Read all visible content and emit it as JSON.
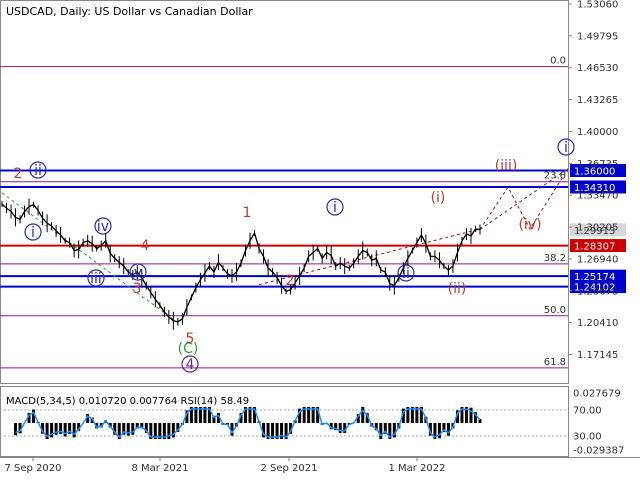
{
  "chart_data": {
    "type": "line",
    "title": "USDCAD, Daily:  US Dollar vs Canadian Dollar",
    "x_ticks": [
      "7 Sep 2020",
      "8 Mar 2021",
      "2 Sep 2021",
      "1 Mar 2022"
    ],
    "ylim": [
      1.154,
      1.532
    ],
    "y_ticks": [
      "1.53060",
      "1.49795",
      "1.46530",
      "1.43265",
      "1.40000",
      "1.36735",
      "1.33470",
      "1.30205",
      "1.26940",
      "1.23675",
      "1.20410",
      "1.17145"
    ],
    "price_label": "1.29913",
    "price_value": 1.29913,
    "key_levels": [
      {
        "label": "1.36000",
        "value": 1.36,
        "color": "#0000cc"
      },
      {
        "label": "1.34310",
        "value": 1.3431,
        "color": "#0000cc"
      },
      {
        "label": "1.28307",
        "value": 1.28307,
        "color": "#cc0000"
      },
      {
        "label": "1.25174",
        "value": 1.25174,
        "color": "#0000cc"
      },
      {
        "label": "1.24102",
        "value": 1.24102,
        "color": "#0000cc"
      }
    ],
    "fib_levels": [
      {
        "label": "0.0",
        "value": 1.4664
      },
      {
        "label": "23.6",
        "value": 1.3485
      },
      {
        "label": "38.2",
        "value": 1.2643
      },
      {
        "label": "50.0",
        "value": 1.2111
      },
      {
        "label": "61.8",
        "value": 1.1578
      }
    ],
    "price_series": [
      1.3256,
      1.3215,
      1.318,
      1.312,
      1.31,
      1.318,
      1.323,
      1.325,
      1.319,
      1.311,
      1.306,
      1.303,
      1.298,
      1.294,
      1.288,
      1.286,
      1.278,
      1.279,
      1.286,
      1.288,
      1.285,
      1.28,
      1.283,
      1.288,
      1.275,
      1.27,
      1.266,
      1.262,
      1.256,
      1.253,
      1.256,
      1.25,
      1.242,
      1.235,
      1.228,
      1.222,
      1.215,
      1.21,
      1.206,
      1.205,
      1.208,
      1.22,
      1.23,
      1.24,
      1.248,
      1.255,
      1.262,
      1.256,
      1.266,
      1.26,
      1.254,
      1.252,
      1.256,
      1.265,
      1.278,
      1.288,
      1.296,
      1.28,
      1.272,
      1.26,
      1.256,
      1.25,
      1.242,
      1.236,
      1.238,
      1.245,
      1.252,
      1.26,
      1.272,
      1.276,
      1.28,
      1.27,
      1.276,
      1.273,
      1.262,
      1.265,
      1.262,
      1.26,
      1.265,
      1.272,
      1.278,
      1.276,
      1.268,
      1.27,
      1.258,
      1.256,
      1.244,
      1.242,
      1.25,
      1.26,
      1.27,
      1.278,
      1.286,
      1.294,
      1.285,
      1.272,
      1.272,
      1.268,
      1.262,
      1.258,
      1.262,
      1.276,
      1.288,
      1.295,
      1.293,
      1.3,
      1.2995
    ],
    "wave_labels": [
      {
        "text": "2",
        "style": "red"
      },
      {
        "text": "ii",
        "style": "blue-circled"
      },
      {
        "text": "i",
        "style": "blue-circled"
      },
      {
        "text": "iv",
        "style": "blue-circled"
      },
      {
        "text": "4",
        "style": "red"
      },
      {
        "text": "iii",
        "style": "blue-circled"
      },
      {
        "text": "v",
        "style": "blue-circled"
      },
      {
        "text": "3",
        "style": "red"
      },
      {
        "text": "5",
        "style": "red"
      },
      {
        "text": "(C)",
        "style": "green"
      },
      {
        "text": "4",
        "style": "purple-circled"
      },
      {
        "text": "1",
        "style": "red"
      },
      {
        "text": "2",
        "style": "red"
      },
      {
        "text": "i",
        "style": "blue-circled"
      },
      {
        "text": "ii",
        "style": "blue-circled"
      },
      {
        "text": "(i)",
        "style": "red"
      },
      {
        "text": "(ii)",
        "style": "red"
      },
      {
        "text": "(iii)",
        "style": "red"
      },
      {
        "text": "(iv)",
        "style": "red"
      },
      {
        "text": "i",
        "style": "blue-circled"
      }
    ],
    "indicator": {
      "label": "MACD(5,34,5) 0.010720 0.007764 RSI(14) 58.49",
      "y_ticks": [
        "0.027679",
        "70.00",
        "30.00",
        "-0.029387"
      ]
    }
  }
}
